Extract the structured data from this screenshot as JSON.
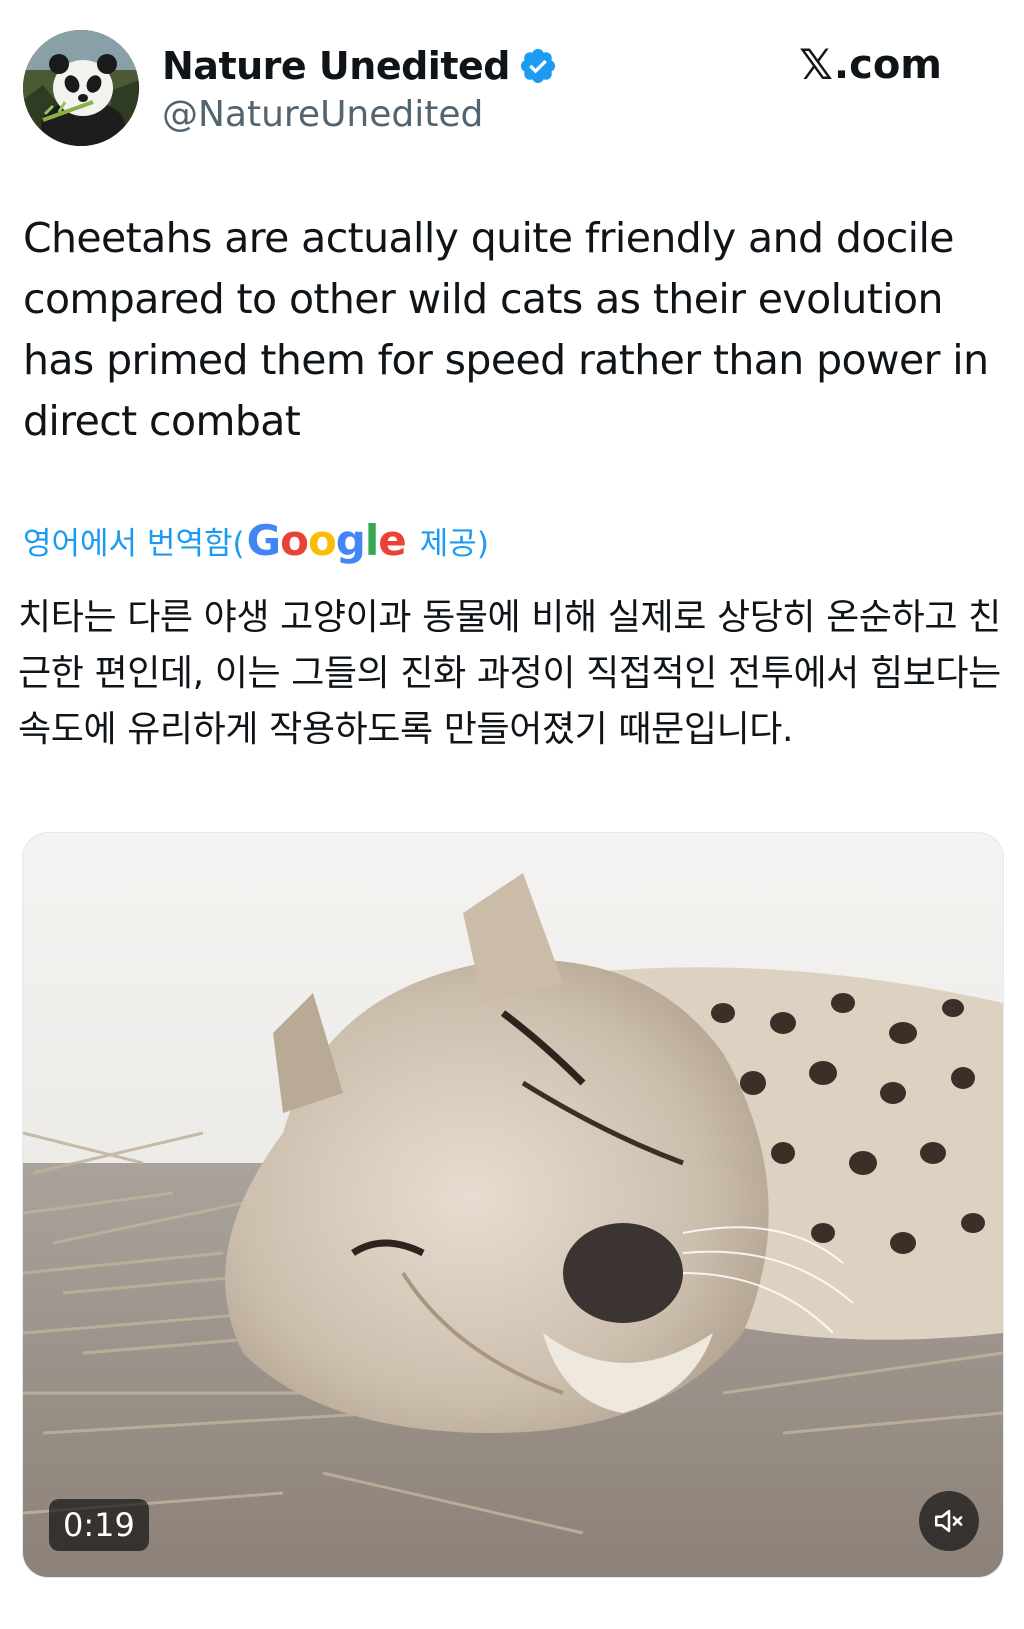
{
  "author": {
    "name": "Nature Unedited",
    "handle": "@NatureUnedited",
    "verified": true,
    "avatar_icon": "panda-avatar"
  },
  "brand": {
    "mark": "𝕏",
    "suffix": ".com"
  },
  "tweet": {
    "text": "Cheetahs are actually quite friendly and docile compared to other wild cats as their evolution has primed them for speed rather than power in direct combat"
  },
  "translation": {
    "prefix": "영어에서 번역함(",
    "google_logo": "Google",
    "suffix": "제공)",
    "text": "치타는 다른 야생 고양이과 동물에 비해 실제로 상당히 온순하고 친근한 편인데, 이는 그들의 진화 과정이 직접적인 전투에서 힘보다는 속도에 유리하게 작용하도록 만들어졌기 때문입니다."
  },
  "media": {
    "type": "video",
    "subject_icon": "sleeping-cheetah-image",
    "duration": "0:19",
    "muted": true,
    "mute_icon": "speaker-muted-icon"
  },
  "colors": {
    "accent_blue": "#1d9bf0",
    "verified_blue": "#1d9bf0",
    "text_primary": "#0f1419",
    "text_secondary": "#536471"
  }
}
